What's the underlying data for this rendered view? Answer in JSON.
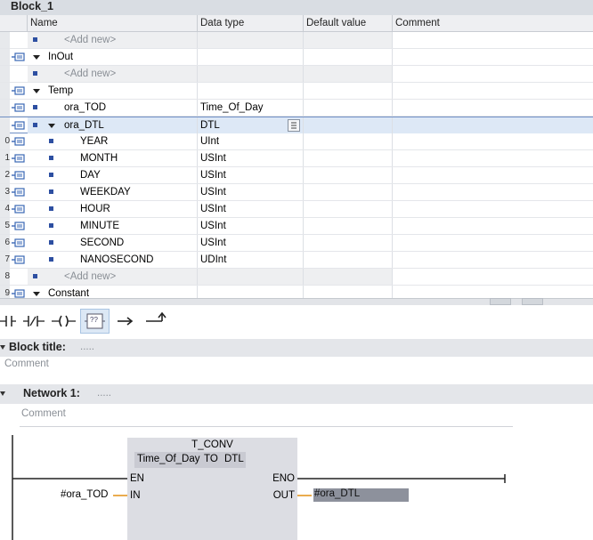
{
  "block": {
    "name": "Block_1"
  },
  "table": {
    "headers": {
      "name": "Name",
      "type": "Data type",
      "default": "Default value",
      "comment": "Comment"
    },
    "rows": [
      {
        "num": "",
        "name": "<Add new>",
        "type": "",
        "kind": "add"
      },
      {
        "num": "",
        "name": "InOut",
        "type": "",
        "kind": "section"
      },
      {
        "num": "",
        "name": "<Add new>",
        "type": "",
        "kind": "add"
      },
      {
        "num": "",
        "name": "Temp",
        "type": "",
        "kind": "section"
      },
      {
        "num": "",
        "name": "ora_TOD",
        "type": "Time_Of_Day",
        "kind": "var"
      },
      {
        "num": "",
        "name": "ora_DTL",
        "type": "DTL",
        "kind": "struct"
      },
      {
        "num": "0",
        "name": "YEAR",
        "type": "UInt",
        "kind": "member"
      },
      {
        "num": "1",
        "name": "MONTH",
        "type": "USInt",
        "kind": "member"
      },
      {
        "num": "2",
        "name": "DAY",
        "type": "USInt",
        "kind": "member"
      },
      {
        "num": "3",
        "name": "WEEKDAY",
        "type": "USInt",
        "kind": "member"
      },
      {
        "num": "4",
        "name": "HOUR",
        "type": "USInt",
        "kind": "member"
      },
      {
        "num": "5",
        "name": "MINUTE",
        "type": "USInt",
        "kind": "member"
      },
      {
        "num": "6",
        "name": "SECOND",
        "type": "USInt",
        "kind": "member"
      },
      {
        "num": "7",
        "name": "NANOSECOND",
        "type": "UDInt",
        "kind": "member"
      },
      {
        "num": "8",
        "name": "<Add new>",
        "type": "",
        "kind": "add"
      },
      {
        "num": "9",
        "name": "Constant",
        "type": "",
        "kind": "section"
      }
    ]
  },
  "toolbar": {
    "items": [
      "no-contact-icon",
      "nc-contact-icon",
      "coil-icon",
      "empty-box-icon",
      "open-branch-icon",
      "close-branch-icon"
    ],
    "empty_box_label": "??"
  },
  "block_title": {
    "label": "Block title:",
    "dots": ".....",
    "comment": "Comment"
  },
  "network": {
    "label": "Network 1:",
    "dots": ".....",
    "comment": "Comment",
    "instruction": {
      "name": "T_CONV",
      "from_type": "Time_Of_Day",
      "to_word": "TO",
      "to_type": "DTL",
      "en": "EN",
      "eno": "ENO",
      "in": "IN",
      "out": "OUT"
    },
    "in_operand": "#ora_TOD",
    "out_operand": "#ora_DTL"
  },
  "colors": {
    "accent": "#2d4fa1",
    "selection": "#dde8f6",
    "wire_orange": "#e8a33a",
    "box": "#dcdde3"
  }
}
